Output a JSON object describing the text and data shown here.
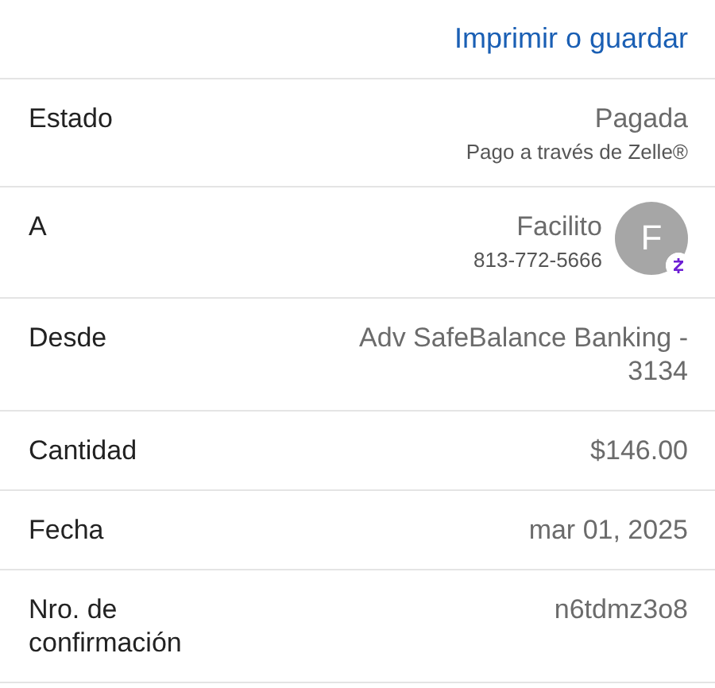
{
  "header": {
    "action": "Imprimir o guardar"
  },
  "rows": [
    {
      "kind": "text",
      "label": "Estado",
      "value": "Pagada",
      "note": "Pago a través de Zelle®"
    },
    {
      "kind": "contact",
      "label": "A",
      "value": "Facilito",
      "note": "813-772-5666",
      "initial": "F"
    },
    {
      "kind": "text",
      "label": "Desde",
      "value": "Adv SafeBalance Banking -\n3134"
    },
    {
      "kind": "text",
      "label": "Cantidad",
      "value": "$146.00"
    },
    {
      "kind": "text",
      "label": "Fecha",
      "value": "mar 01, 2025"
    },
    {
      "kind": "text",
      "label": "Nro. de\nconfirmación",
      "value": "n6tdmz3o8"
    }
  ]
}
